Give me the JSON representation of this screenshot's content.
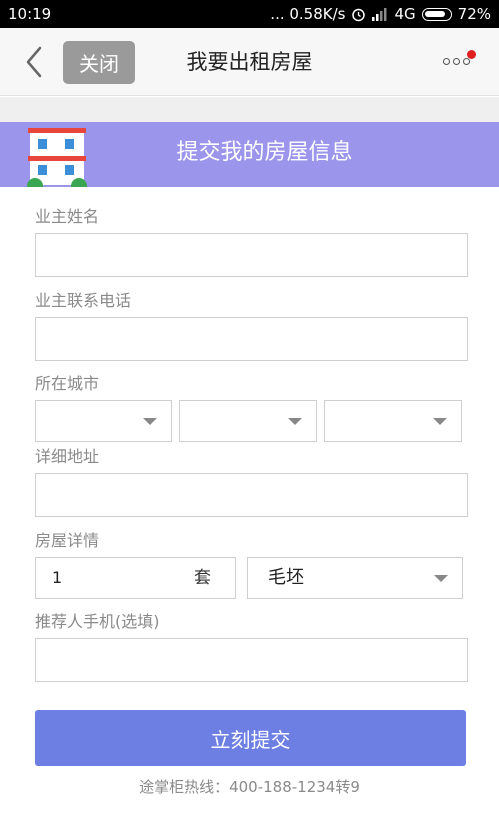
{
  "status_bar": {
    "time": "10:19",
    "network_speed": "... 0.58K/s",
    "network_type": "4G",
    "battery": "72%"
  },
  "nav": {
    "back_icon": "chevron-left-icon",
    "close_label": "关闭",
    "title": "我要出租房屋",
    "more_icon": "more-dots-icon",
    "notification_color": "#e02020"
  },
  "banner": {
    "icon": "house-icon",
    "title": "提交我的房屋信息",
    "color": "#9b95ec"
  },
  "form": {
    "owner_name": {
      "label": "业主姓名",
      "value": ""
    },
    "owner_phone": {
      "label": "业主联系电话",
      "value": ""
    },
    "city": {
      "label": "所在城市",
      "selects": [
        "",
        "",
        ""
      ]
    },
    "address": {
      "label": "详细地址",
      "value": ""
    },
    "house_details": {
      "label": "房屋详情",
      "count_value": "1",
      "count_unit": "套",
      "decoration_value": "毛坯"
    },
    "referrer_phone": {
      "label": "推荐人手机(选填)",
      "value": ""
    }
  },
  "submit": {
    "label": "立刻提交",
    "color": "#6d7fe3"
  },
  "footer": {
    "hotline": "途掌柜热线：400-188-1234转9"
  }
}
